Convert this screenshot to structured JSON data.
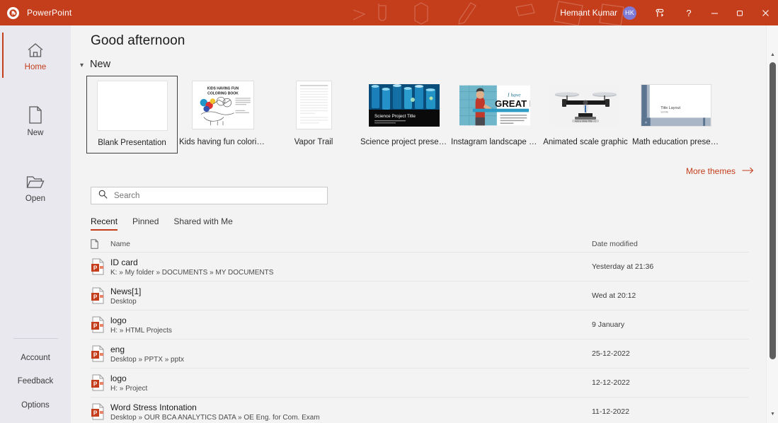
{
  "titlebar": {
    "app_name": "PowerPoint",
    "app_icon": "powerpoint-logo-icon",
    "user_name": "Hemant Kumar",
    "avatar_initials": "HK",
    "ribbon_display_icon": "ribbon-display-options-icon",
    "help_label": "?",
    "minimize_label": "—",
    "restore_label": "❐",
    "close_label": "✕",
    "bg_color": "#c43e1c"
  },
  "sidebar": {
    "items": [
      {
        "label": "Home",
        "icon": "home-icon",
        "active": true
      },
      {
        "label": "New",
        "icon": "new-document-icon",
        "active": false
      },
      {
        "label": "Open",
        "icon": "open-folder-icon",
        "active": false
      }
    ],
    "bottom_links": [
      {
        "label": "Account"
      },
      {
        "label": "Feedback"
      },
      {
        "label": "Options"
      }
    ]
  },
  "main": {
    "greeting": "Good afternoon",
    "new_section": {
      "title": "New",
      "collapse_icon": "chevron-down-icon",
      "more_themes_label": "More themes",
      "more_themes_icon": "arrow-right-icon",
      "templates": [
        {
          "label": "Blank Presentation",
          "thumb": "blank-slide",
          "selected": true
        },
        {
          "label": "Kids having fun coloring bo...",
          "thumb": "kids-coloring-book",
          "selected": false
        },
        {
          "label": "Vapor Trail",
          "thumb": "vapor-trail-lines",
          "selected": false
        },
        {
          "label": "Science project presentatio...",
          "thumb": "science-test-tubes",
          "selected": false
        },
        {
          "label": "Instagram landscape for ne...",
          "thumb": "great-news-instagram",
          "selected": false
        },
        {
          "label": "Animated scale graphic",
          "thumb": "animated-scale",
          "selected": false
        },
        {
          "label": "Math education presentatio...",
          "thumb": "math-title-layout",
          "selected": false
        }
      ],
      "thumb_text": {
        "kids_line1": "KIDS HAVING FUN",
        "kids_line2": "COLORING BOOK",
        "science_title": "Science Project Title",
        "news_small": "I have",
        "news_big": "GREAT NEWS",
        "scale_caption": "Add a Slide Title - 1",
        "math_title": "Title Layout",
        "math_subtitle": "Subtitle",
        "math_symbol": "π"
      }
    },
    "search": {
      "placeholder": "Search",
      "value": "",
      "icon": "search-icon"
    },
    "tabs": [
      {
        "label": "Recent",
        "active": true
      },
      {
        "label": "Pinned",
        "active": false
      },
      {
        "label": "Shared with Me",
        "active": false
      }
    ],
    "file_list": {
      "columns": {
        "icon": "document-icon",
        "name": "Name",
        "date_modified": "Date modified"
      },
      "rows": [
        {
          "icon": "powerpoint-file-icon",
          "name": "ID card",
          "path": "K: » My folder » DOCUMENTS » MY DOCUMENTS",
          "date": "Yesterday at 21:36"
        },
        {
          "icon": "powerpoint-file-icon",
          "name": "News[1]",
          "path": "Desktop",
          "date": "Wed at 20:12"
        },
        {
          "icon": "powerpoint-file-icon",
          "name": "logo",
          "path": "H: » HTML Projects",
          "date": "9 January"
        },
        {
          "icon": "powerpoint-file-icon",
          "name": "eng",
          "path": "Desktop » PPTX » pptx",
          "date": "25-12-2022"
        },
        {
          "icon": "powerpoint-file-icon",
          "name": "logo",
          "path": "H: » Project",
          "date": "12-12-2022"
        },
        {
          "icon": "powerpoint-file-icon",
          "name": "Word Stress  Intonation",
          "path": "Desktop » OUR BCA ANALYTICS DATA » OE Eng. for Com. Exam",
          "date": "11-12-2022"
        }
      ]
    }
  },
  "scrollbar": {
    "up_arrow": "scroll-up-arrow-icon",
    "down_arrow": "scroll-down-arrow-icon"
  }
}
